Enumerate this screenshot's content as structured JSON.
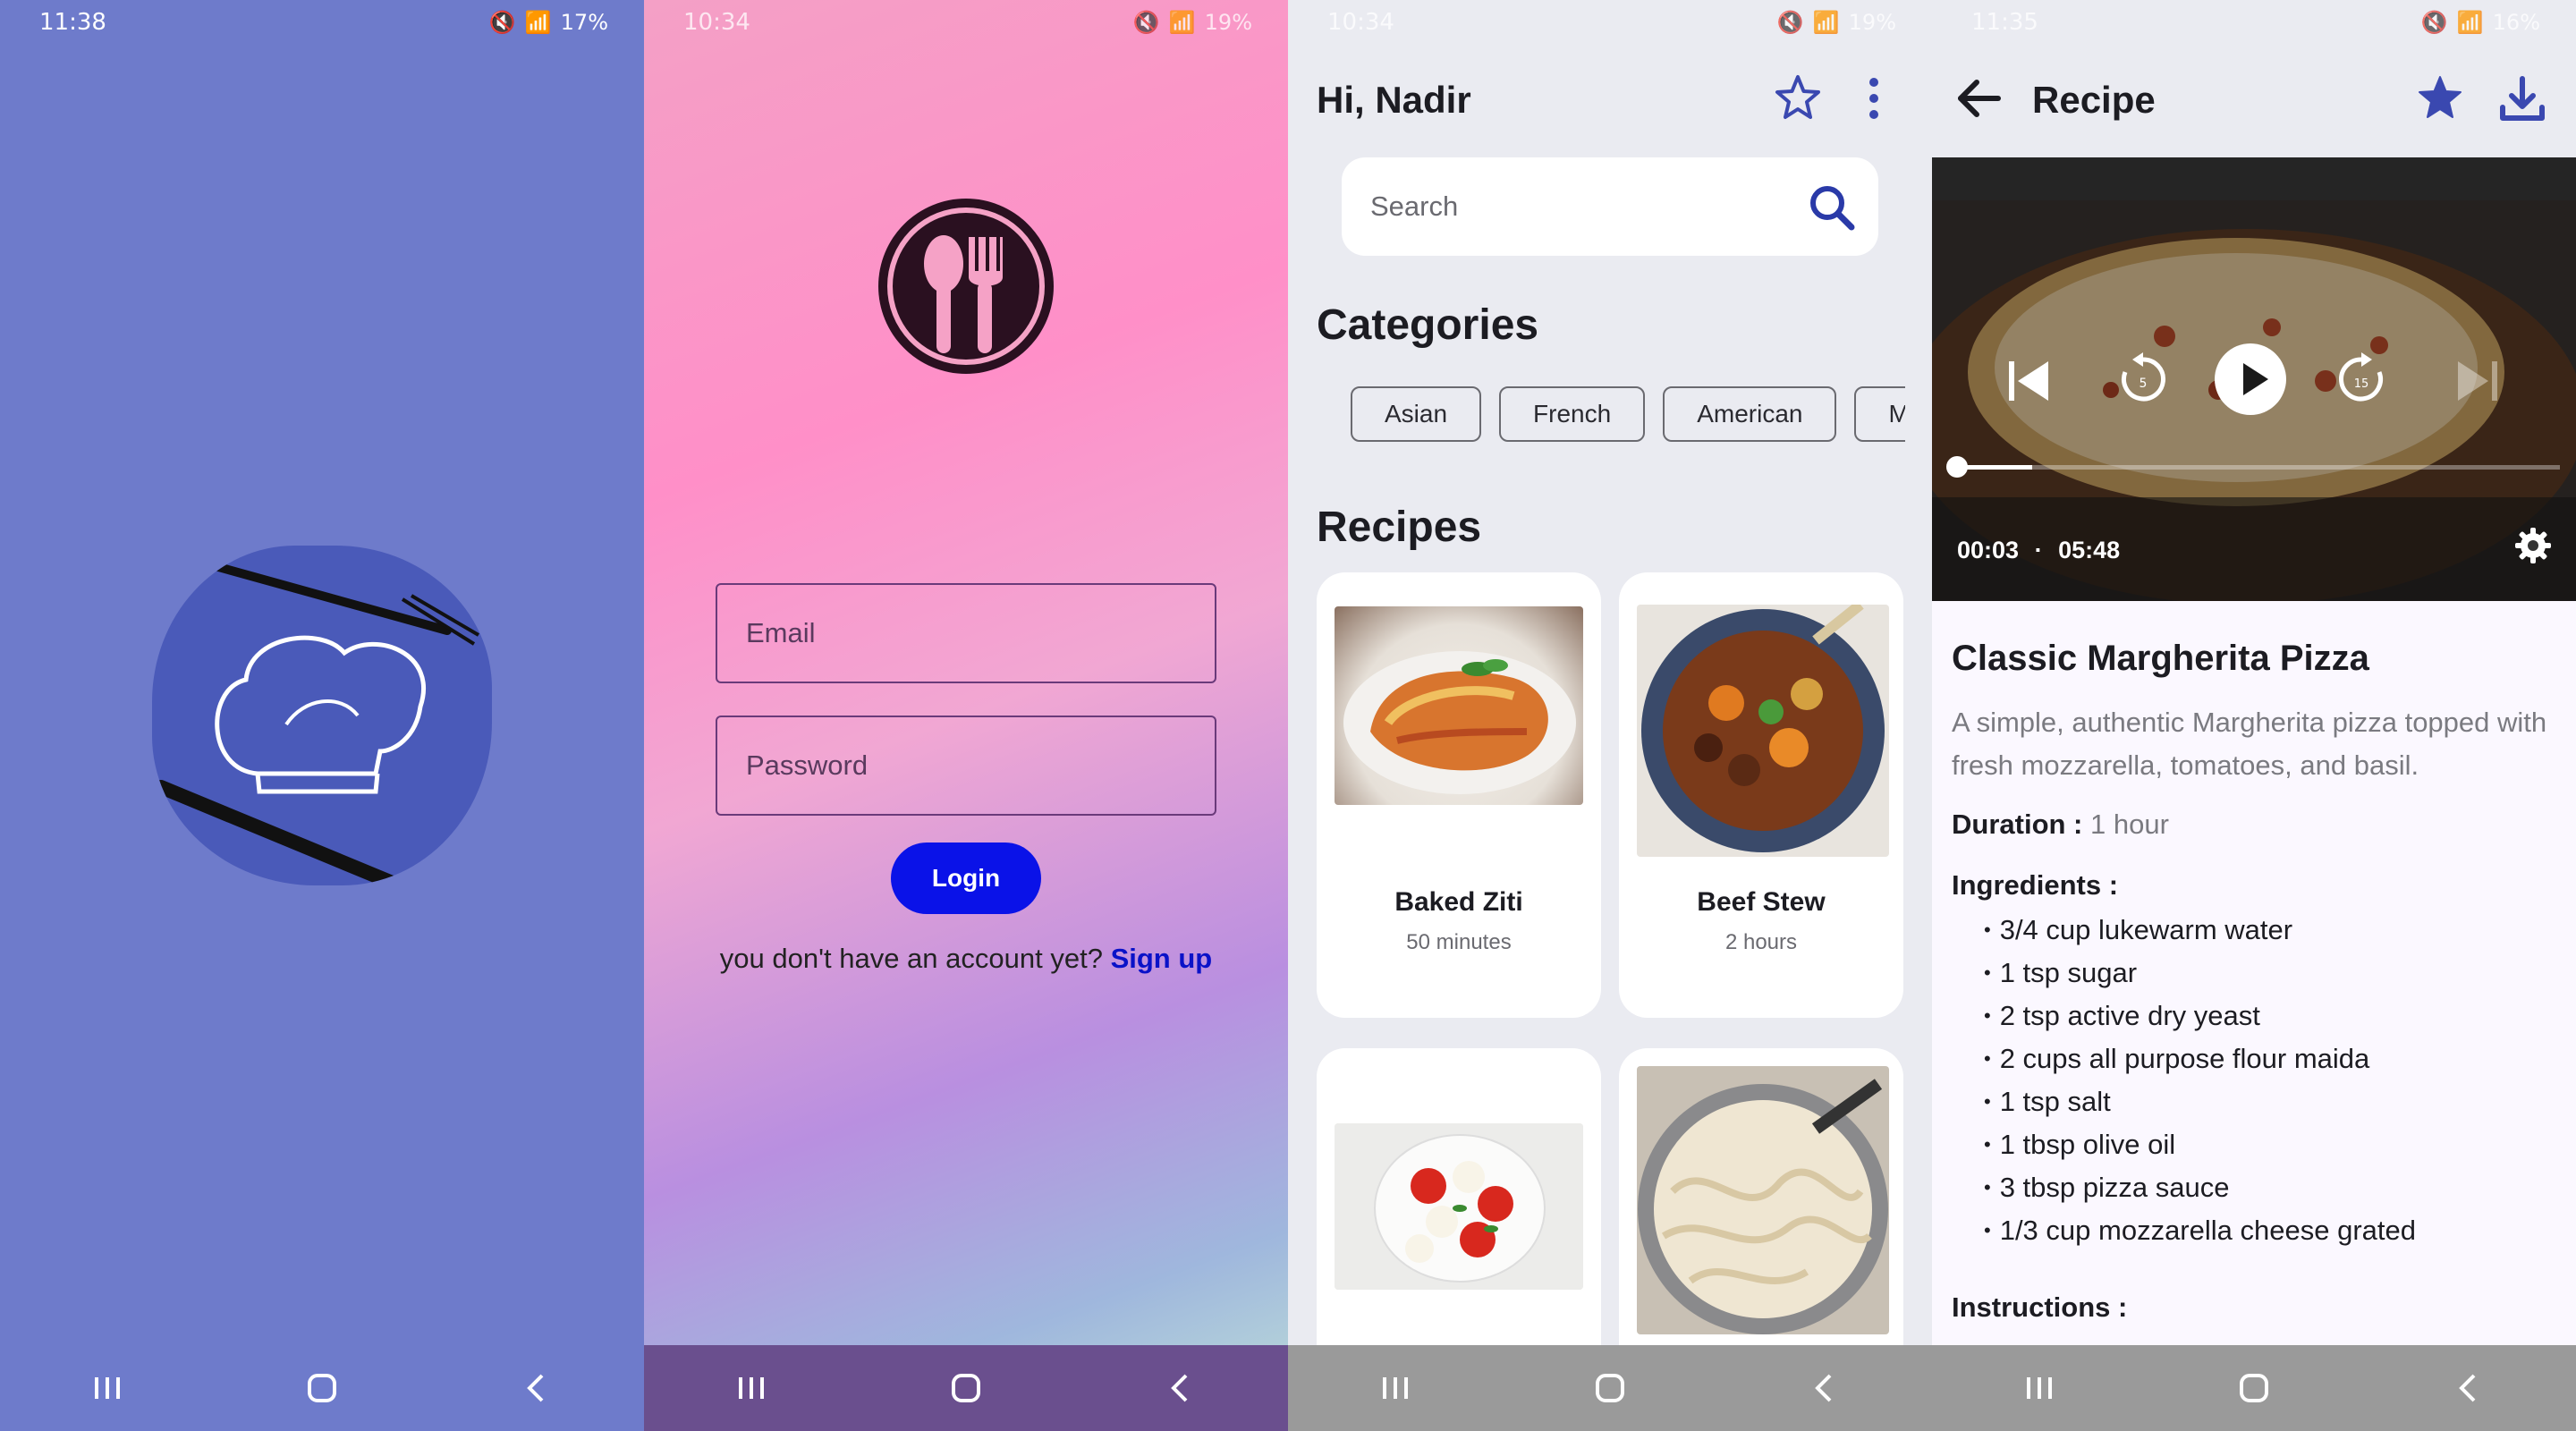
{
  "screens": {
    "splash": {
      "status": {
        "time": "11:38",
        "battery": "17%"
      }
    },
    "login": {
      "status": {
        "time": "10:34",
        "battery": "19%"
      },
      "email_placeholder": "Email",
      "password_placeholder": "Password",
      "login_label": "Login",
      "signup_prompt": "you don't have an account yet?",
      "signup_link": "Sign up"
    },
    "home": {
      "status": {
        "time": "10:34",
        "battery": "19%"
      },
      "greeting": "Hi, Nadir",
      "search_placeholder": "Search",
      "categories_title": "Categories",
      "categories": [
        "Asian",
        "French",
        "American",
        "Mexican"
      ],
      "recipes_title": "Recipes",
      "recipes": [
        {
          "name": "Baked Ziti",
          "time": "50 minutes"
        },
        {
          "name": "Beef Stew",
          "time": "2 hours"
        },
        {
          "name": "",
          "time": ""
        },
        {
          "name": "",
          "time": ""
        }
      ]
    },
    "recipe": {
      "status": {
        "time": "11:35",
        "battery": "16%"
      },
      "header_title": "Recipe",
      "video": {
        "current": "00:03",
        "separator": "·",
        "duration": "05:48",
        "progress": 0.009
      },
      "title": "Classic Margherita Pizza",
      "description": "A simple, authentic Margherita pizza topped with fresh mozzarella, tomatoes, and basil.",
      "duration_label": "Duration :",
      "duration_value": "1 hour",
      "ingredients_label": "Ingredients :",
      "ingredients": [
        "3/4 cup lukewarm water",
        "1 tsp sugar",
        "2 tsp active dry yeast",
        "2 cups all purpose flour maida",
        "1 tsp salt",
        "1 tbsp olive oil",
        "3 tbsp pizza sauce",
        "1/3 cup mozzarella cheese grated"
      ],
      "instructions_label": "Instructions :"
    }
  },
  "colors": {
    "splash_bg": "#6e7bcb",
    "login_button": "#0a12e8",
    "accent_blue": "#3040b0"
  },
  "icons": [
    "chef-hat-icon",
    "spoon-fork-icon",
    "star-outline-icon",
    "more-vert-icon",
    "search-icon",
    "back-arrow-icon",
    "star-filled-icon",
    "download-icon",
    "skip-previous-icon",
    "replay-5-icon",
    "play-icon",
    "forward-15-icon",
    "skip-next-icon",
    "settings-icon",
    "recents-icon",
    "home-icon",
    "back-icon"
  ]
}
